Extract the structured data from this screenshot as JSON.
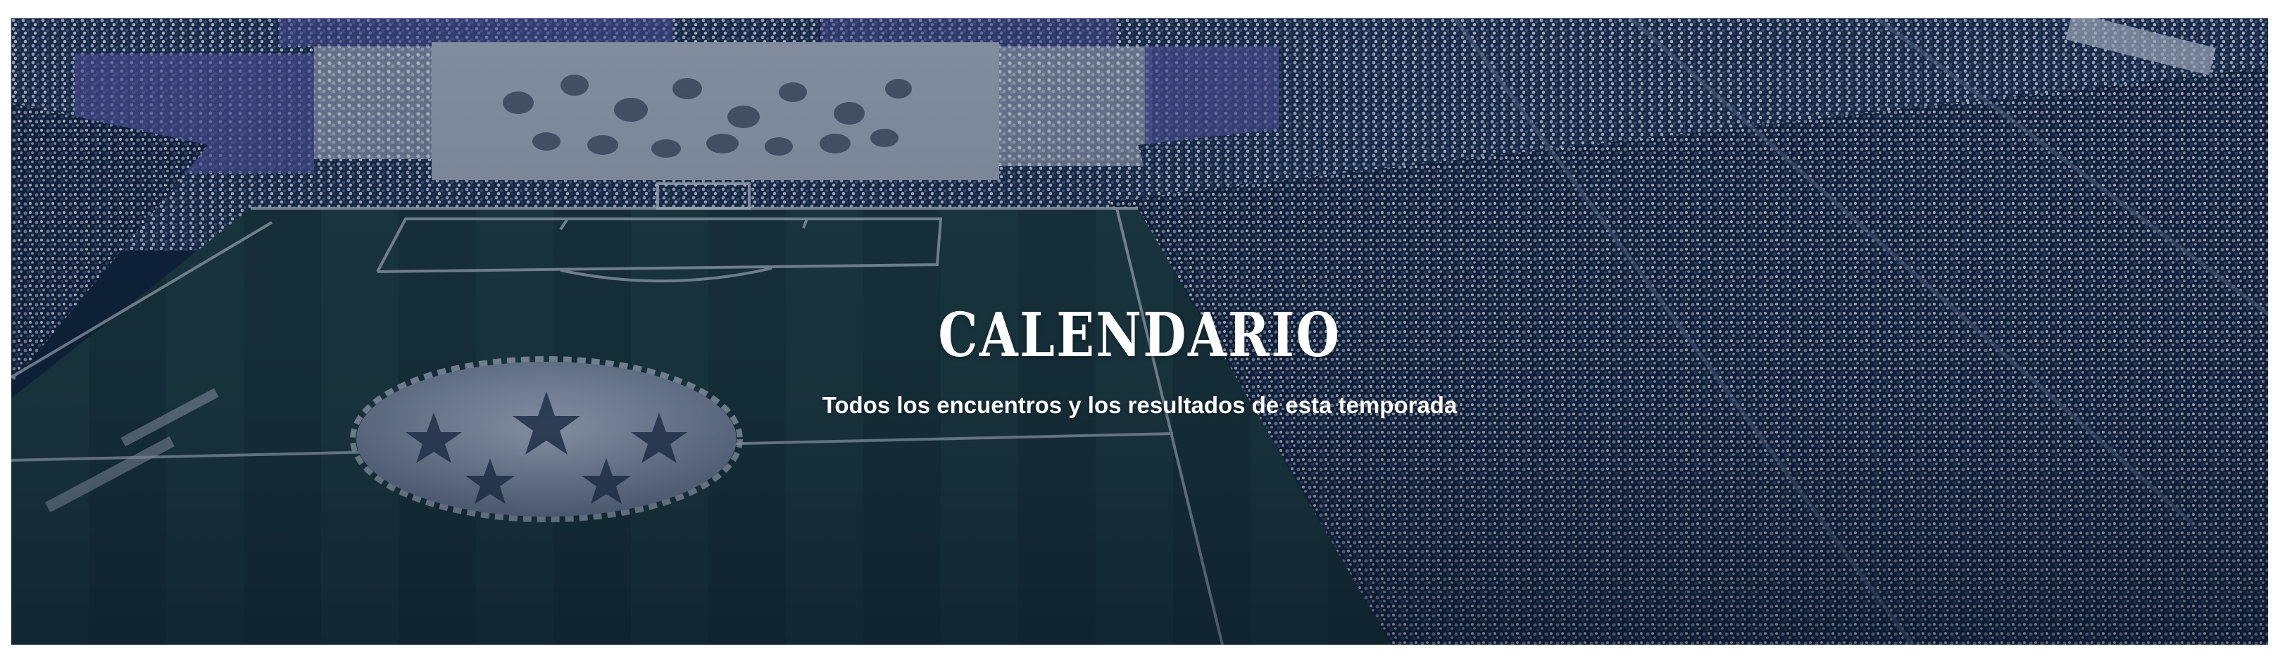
{
  "hero": {
    "title": "CALENDARIO",
    "subtitle": "Todos los encuentros y los resultados de esta temporada"
  },
  "colors": {
    "overlay": "#0f2238",
    "text": "#ffffff",
    "pitch": "#1d3b3f",
    "crowd_light": "#9aa8c4",
    "crowd_purple": "#6a6fb8"
  },
  "icons": {
    "background": "stadium-photo",
    "pitch_logo": "star-ball-icon"
  }
}
